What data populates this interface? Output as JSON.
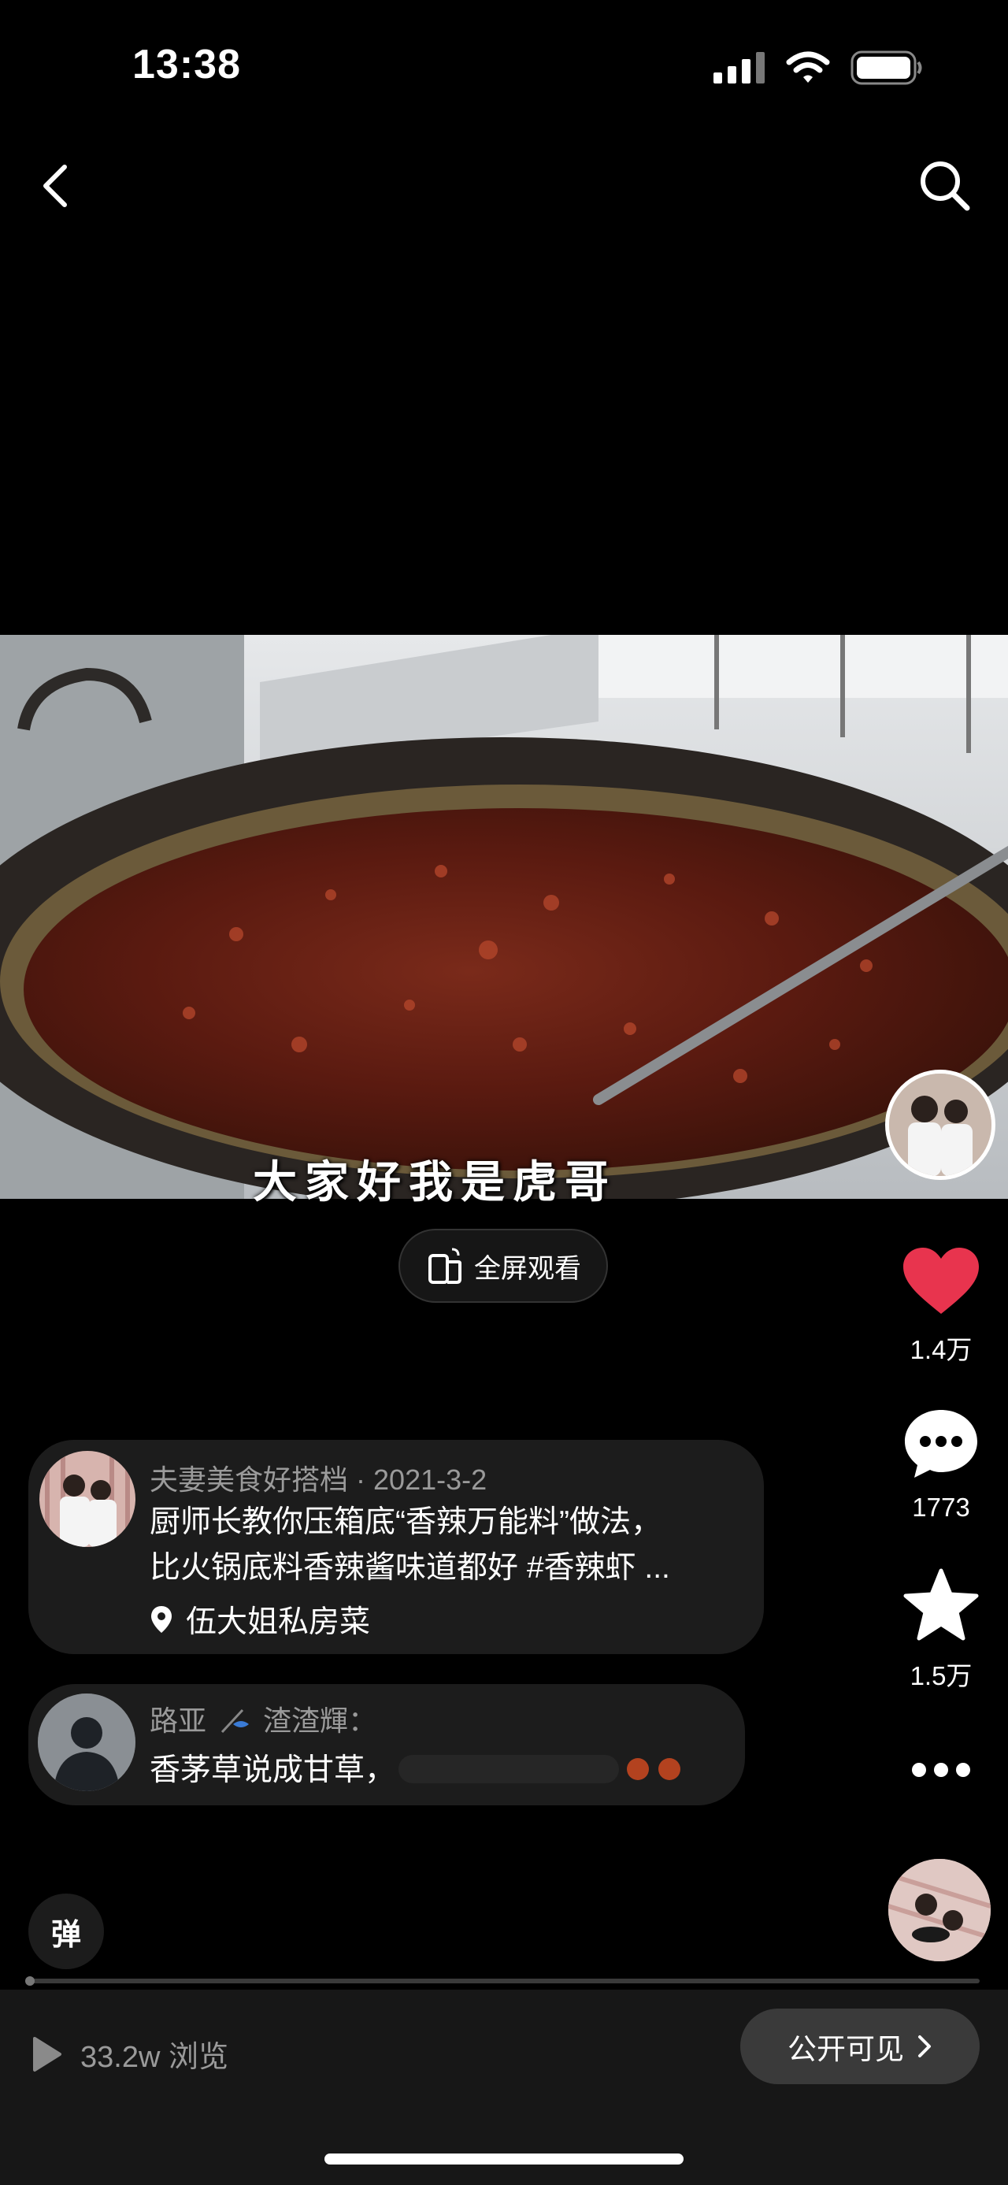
{
  "status_bar": {
    "time": "13:38"
  },
  "video": {
    "subtitle": "大家好我是虎哥",
    "fullscreen_label": "全屏观看"
  },
  "actions": {
    "likes": "1.4万",
    "comments": "1773",
    "favorites": "1.5万"
  },
  "post": {
    "author": "夫妻美食好搭档",
    "date": "2021-3-2",
    "desc_line1": "厨师长教你压箱底“香辣万能料”做法，",
    "desc_line2": "比火锅底料香辣酱味道都好 #香辣虾 ...",
    "location": "伍大姐私房菜"
  },
  "comment": {
    "user_a": "路亚",
    "user_b": "渣渣輝",
    "text": "香茅草说成甘草，"
  },
  "danmu_label": "弹",
  "bottom": {
    "views": "33.2w 浏览",
    "visibility": "公开可见"
  },
  "colors": {
    "like": "#e8344e",
    "background": "#000000",
    "card": "#1c1c1c"
  }
}
